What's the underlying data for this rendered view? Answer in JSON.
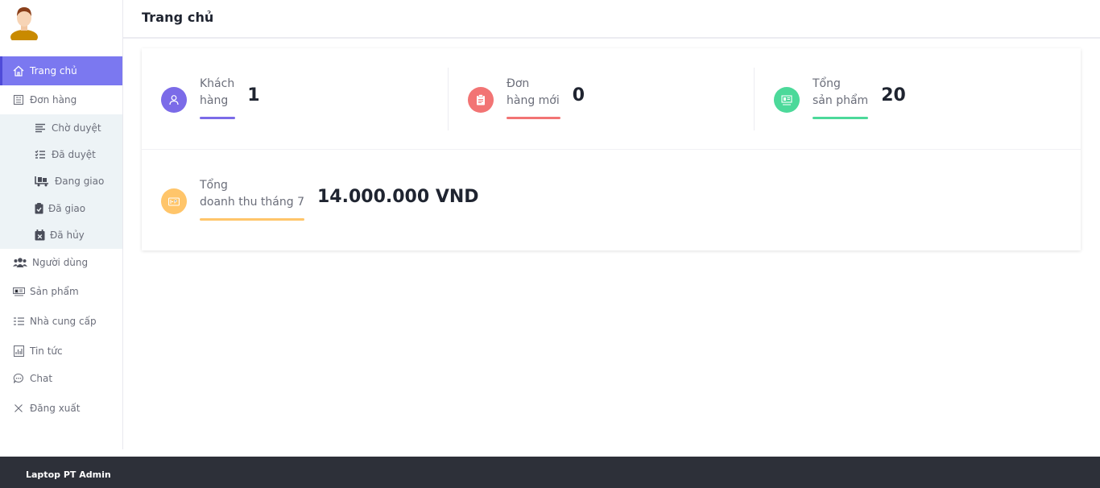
{
  "header": {
    "title": "Trang chủ"
  },
  "sidebar": {
    "items": [
      {
        "label": "Trang chủ",
        "icon": "home-icon"
      },
      {
        "label": "Đơn hàng",
        "icon": "orders-icon"
      },
      {
        "label": "Người dùng",
        "icon": "users-icon"
      },
      {
        "label": "Sản phẩm",
        "icon": "products-icon"
      },
      {
        "label": "Nhà cung cấp",
        "icon": "suppliers-icon"
      },
      {
        "label": "Tin tức",
        "icon": "news-icon"
      },
      {
        "label": "Chat",
        "icon": "chat-icon"
      },
      {
        "label": "Đăng xuất",
        "icon": "close-icon"
      }
    ],
    "subitems": [
      {
        "label": "Chờ duyệt",
        "icon": "list-icon"
      },
      {
        "label": "Đã duyệt",
        "icon": "checklist-icon"
      },
      {
        "label": "Đang giao",
        "icon": "delivery-icon"
      },
      {
        "label": "Đã giao",
        "icon": "clipboard-check-icon"
      },
      {
        "label": "Đã hủy",
        "icon": "calendar-x-icon"
      }
    ]
  },
  "stats": {
    "customers": {
      "label1": "Khách",
      "label2": "hàng",
      "value": "1",
      "color": "#7b6be8"
    },
    "new_orders": {
      "label1": "Đơn",
      "label2": "hàng mới",
      "value": "0",
      "color": "#f27474"
    },
    "total_products": {
      "label1": "Tổng",
      "label2": "sản phẩm",
      "value": "20",
      "color": "#4cd99a"
    },
    "revenue": {
      "label1": "Tổng",
      "label2": "doanh thu tháng 7",
      "value": "14.000.000 VND",
      "color": "#ffc56a"
    }
  },
  "footer": {
    "text": "Laptop PT Admin"
  }
}
